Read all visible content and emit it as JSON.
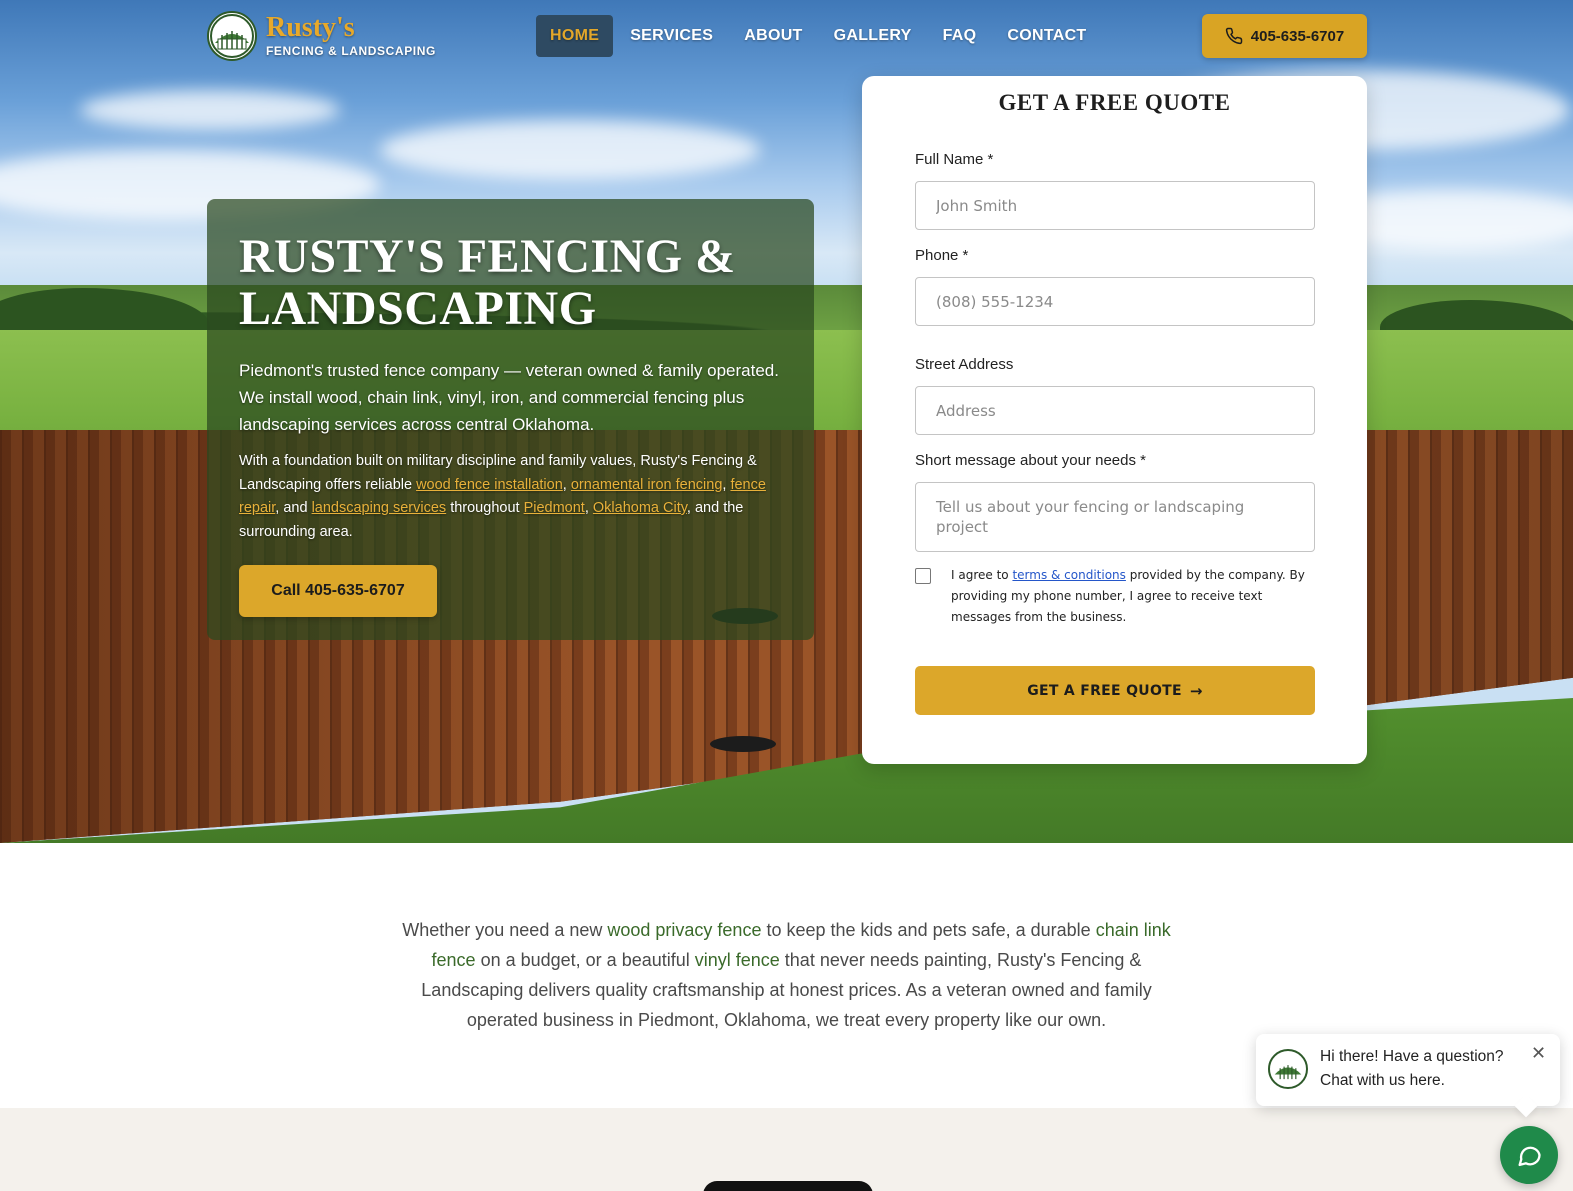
{
  "brand": {
    "name": "Rusty's",
    "tagline": "FENCING & LANDSCAPING"
  },
  "nav": {
    "items": [
      {
        "label": "HOME",
        "active": true
      },
      {
        "label": "SERVICES",
        "active": false
      },
      {
        "label": "ABOUT",
        "active": false
      },
      {
        "label": "GALLERY",
        "active": false
      },
      {
        "label": "FAQ",
        "active": false
      },
      {
        "label": "CONTACT",
        "active": false
      }
    ],
    "phone": "405-635-6707"
  },
  "hero": {
    "title": "RUSTY'S FENCING & LANDSCAPING",
    "lead": "Piedmont's trusted fence company — veteran owned & family operated. We install wood, chain link, vinyl, iron, and commercial fencing plus landscaping services across central Oklahoma.",
    "body": {
      "t1": "With a foundation built on military discipline and family values, Rusty's Fencing & Landscaping offers reliable ",
      "l1": "wood fence installation",
      "t2": ", ",
      "l2": "ornamental iron fencing",
      "t3": ", ",
      "l3": "fence repair",
      "t4": ", and ",
      "l4": "landscaping services",
      "t5": " throughout ",
      "l5": "Piedmont",
      "t6": ", ",
      "l6": "Oklahoma City",
      "t7": ", and the surrounding area."
    },
    "cta": "Call 405-635-6707"
  },
  "quote": {
    "title": "GET A FREE QUOTE",
    "name_label": "Full Name *",
    "name_placeholder": "John Smith",
    "phone_label": "Phone *",
    "phone_placeholder": "(808) 555-1234",
    "address_label": "Street Address",
    "address_placeholder": "Address",
    "message_label": "Short message about your needs *",
    "message_placeholder": "Tell us about your fencing or landscaping project",
    "agree_pre": "I agree to ",
    "agree_link": "terms & conditions",
    "agree_post": " provided by the company. By providing my phone number, I agree to receive text messages from the business.",
    "submit": "GET A FREE QUOTE"
  },
  "intro": {
    "p1": "Whether you need a new ",
    "g1": "wood privacy fence",
    "p2": " to keep the kids and pets safe, a durable ",
    "g2": "chain link fence",
    "p3": " on a budget, or a beautiful ",
    "g3": "vinyl fence",
    "p4": " that never needs painting, Rusty's Fencing & Landscaping delivers quality craftsmanship at honest prices. As a veteran owned and family operated business in Piedmont, Oklahoma, we treat every property like our own."
  },
  "chat": {
    "message": "Hi there! Have a question? Chat with us here."
  },
  "colors": {
    "accent": "#dca72a",
    "brand_green": "#2e5a2a",
    "chat_green": "#1f8a4a"
  }
}
